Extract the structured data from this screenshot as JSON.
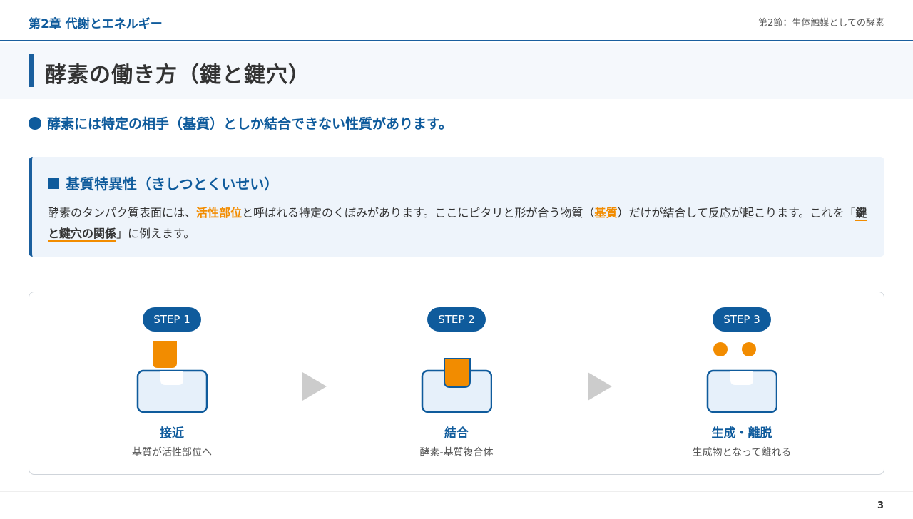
{
  "header": {
    "chapter": "第2章 代謝とエネルギー",
    "section": "第2節：生体触媒としての酵素"
  },
  "page_title": "酵素の働き方（鍵と鍵穴）",
  "lead": "酵素には特定の相手（基質）としか結合できない性質があります。",
  "callout": {
    "heading": "基質特異性（きしつとくいせい）",
    "body_1": "酵素のタンパク質表面には、",
    "highlight_active_site": "活性部位",
    "body_2": "と呼ばれる特定のくぼみがあります。ここにピタリと形が合う物質（",
    "highlight_substrate": "基質",
    "body_3": "）だけが結合して反応が起こります。これを「",
    "emphasis": "鍵と鍵穴の関係",
    "body_4": "」に例えます。"
  },
  "steps": [
    {
      "badge": "STEP 1",
      "name": "接近",
      "desc": "基質が活性部位へ"
    },
    {
      "badge": "STEP 2",
      "name": "結合",
      "desc": "酵素-基質複合体"
    },
    {
      "badge": "STEP 3",
      "name": "生成・離脱",
      "desc": "生成物となって離れる"
    }
  ],
  "colors": {
    "primary": "#0f5b9c",
    "accent": "#f28c00",
    "enzyme_fill": "#e6f0fa",
    "arrow": "#cccccc"
  },
  "icons": {
    "arrow": "play-triangle-icon"
  },
  "page_number": "3"
}
